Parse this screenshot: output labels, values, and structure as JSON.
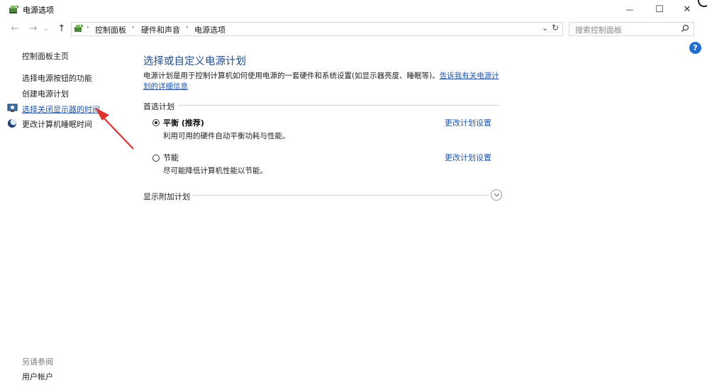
{
  "window": {
    "title": "电源选项",
    "minimize_glyph": "—",
    "maximize_glyph": "☐",
    "close_glyph": "✕"
  },
  "nav": {
    "back_glyph": "←",
    "forward_glyph": "→",
    "recent_glyph": "⌄",
    "up_glyph": "↑",
    "breadcrumbs": [
      "控制面板",
      "硬件和声音",
      "电源选项"
    ],
    "separator": "›",
    "dropdown_glyph": "⌄",
    "refresh_glyph": "↻",
    "search_placeholder": "搜索控制面板"
  },
  "sidebar": {
    "home": "控制面板主页",
    "items": [
      "选择电源按钮的功能",
      "创建电源计划",
      "选择关闭显示器的时间",
      "更改计算机睡眠时间"
    ],
    "see_also_label": "另请参阅",
    "see_also_items": [
      "用户帐户"
    ]
  },
  "main": {
    "heading": "选择或自定义电源计划",
    "description": "电源计划是用于控制计算机如何使用电源的一套硬件和系统设置(如显示器亮度、睡眠等)。",
    "description_link": "告诉我有关电源计划的详细信息",
    "preferred_label": "首选计划",
    "plans": [
      {
        "name": "平衡 (推荐)",
        "desc": "利用可用的硬件自动平衡功耗与性能。",
        "selected": true,
        "link": "更改计划设置"
      },
      {
        "name": "节能",
        "desc": "尽可能降低计算机性能以节能。",
        "selected": false,
        "link": "更改计划设置"
      }
    ],
    "additional_label": "显示附加计划"
  },
  "help_glyph": "?",
  "colors": {
    "link": "#1a56b0",
    "heading": "#1f4e99",
    "annotation_arrow": "#e0322c"
  }
}
